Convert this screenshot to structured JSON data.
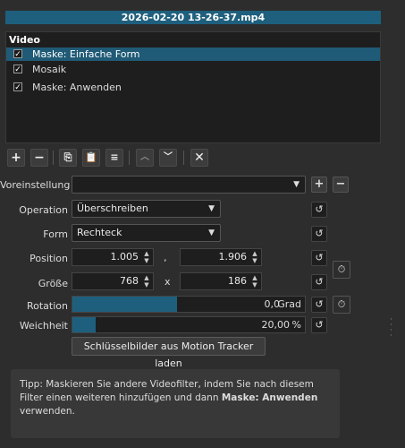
{
  "window": {
    "title": "2026-02-20 13-26-37.mp4"
  },
  "filters": {
    "header": "Video",
    "items": [
      {
        "label": "Maske: Einfache Form",
        "checked": true,
        "selected": true
      },
      {
        "label": "Mosaik",
        "checked": true,
        "selected": false
      },
      {
        "label": "Maske: Anwenden",
        "checked": true,
        "selected": false
      }
    ]
  },
  "toolbar": {
    "add_icon": "plus-icon",
    "remove_icon": "minus-icon",
    "copy_icon": "copy-icon",
    "paste_icon": "paste-icon",
    "save_icon": "database-icon",
    "up_icon": "chevron-up-icon",
    "down_icon": "chevron-down-icon",
    "close_icon": "close-icon"
  },
  "preset": {
    "label": "Voreinstellung",
    "value": ""
  },
  "operation": {
    "label": "Operation",
    "value": "Überschreiben"
  },
  "form": {
    "label": "Form",
    "value": "Rechteck"
  },
  "position": {
    "label": "Position",
    "x": "1.005",
    "sep": ",",
    "y": "1.906"
  },
  "size": {
    "label": "Größe",
    "w": "768",
    "sep": "x",
    "h": "186"
  },
  "rotation": {
    "label": "Rotation",
    "value": "0,0",
    "unit": "Grad",
    "fraction": 0.45
  },
  "softness": {
    "label": "Weichheit",
    "value": "20,00",
    "unit": "%",
    "fraction": 0.1
  },
  "motion_button": {
    "label": "Schlüsselbilder aus Motion Tracker laden"
  },
  "tip": {
    "prefix": "Tipp: Maskieren Sie andere Videofilter, indem Sie nach diesem Filter einen weiteren hinzufügen und dann ",
    "bold": "Maske: Anwenden",
    "suffix": " verwenden."
  },
  "colors": {
    "accent": "#1e5f7e",
    "panel": "#2d2d2d",
    "list": "#1e1e1e"
  }
}
